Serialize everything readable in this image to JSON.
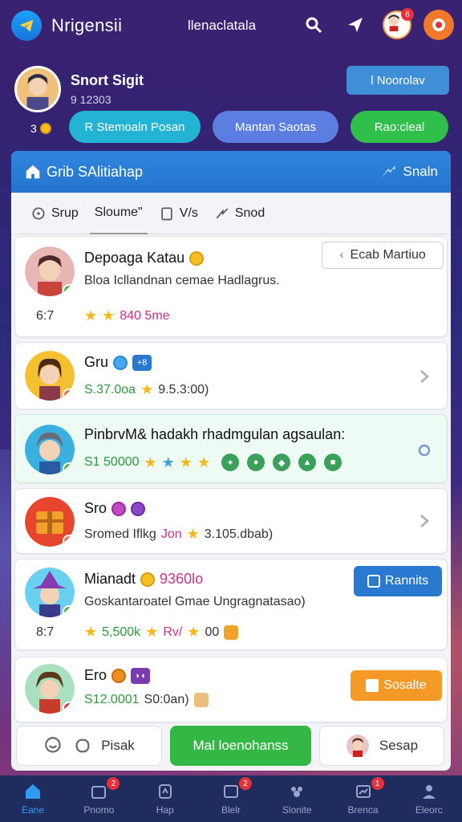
{
  "header": {
    "app_name": "Nrigensii",
    "center_text": "llenaclatala",
    "notif_count": "6"
  },
  "profile": {
    "name": "Snort Sigit",
    "sub": "9 12303",
    "button_label": "l Noorolav",
    "coins": "3",
    "pills": [
      "R Stemoaln Posan",
      "Mantan Saotas",
      "Rao:cleal"
    ]
  },
  "panel": {
    "title": "Grib SAlitiahap",
    "right_label": "Snaln",
    "tabs": [
      "Srup",
      "Sloume\"",
      "V/s",
      "Snod"
    ]
  },
  "cards": [
    {
      "title": "Depoaga Katau",
      "line": "Bloa Icllandnan cemae Hadlagrus.",
      "left": "6:7",
      "rating": "840 5me",
      "action": "Ecab Martiuo"
    },
    {
      "title": "Gru",
      "badge": "+8",
      "line_green": "S.37.0oa",
      "line_rest": "9.5.3:00)"
    },
    {
      "title": "PinbrvM& hadakh rhadmgulan agsaulan:",
      "line_green": "S1 50000"
    },
    {
      "title": "Sro",
      "line": "Sromed Iflkg",
      "line_pink": "Jon",
      "line_rest": "3.105.dbab)"
    },
    {
      "title": "Mianadt",
      "title_pink": "9360lo",
      "line": "Goskantaroatel Gmae Ungragnatasao)",
      "left": "8:7",
      "stats_green": "5,500k",
      "stats_pink": "Rv/",
      "stats_rest": "00",
      "action": "Rannits"
    },
    {
      "title": "Ero",
      "line_green": "S12.0001",
      "line_rest": "S0:0an)",
      "action": "Sosalte"
    }
  ],
  "actions": [
    "Pisak",
    "Mal loenohanss",
    "Sesap"
  ],
  "nav": [
    {
      "label": "Eane",
      "badge": ""
    },
    {
      "label": "Pnomo",
      "badge": "2"
    },
    {
      "label": "Hap",
      "badge": ""
    },
    {
      "label": "Blelr",
      "badge": "2"
    },
    {
      "label": "Slonite",
      "badge": ""
    },
    {
      "label": "Brenca",
      "badge": "1"
    },
    {
      "label": "Eleorc",
      "badge": ""
    }
  ],
  "colors": {
    "topbar": "#3a2272",
    "panel_header": "#2f86de",
    "green_action": "#33b845",
    "blue_action": "#2a79d0",
    "orange_action": "#f59a26"
  }
}
